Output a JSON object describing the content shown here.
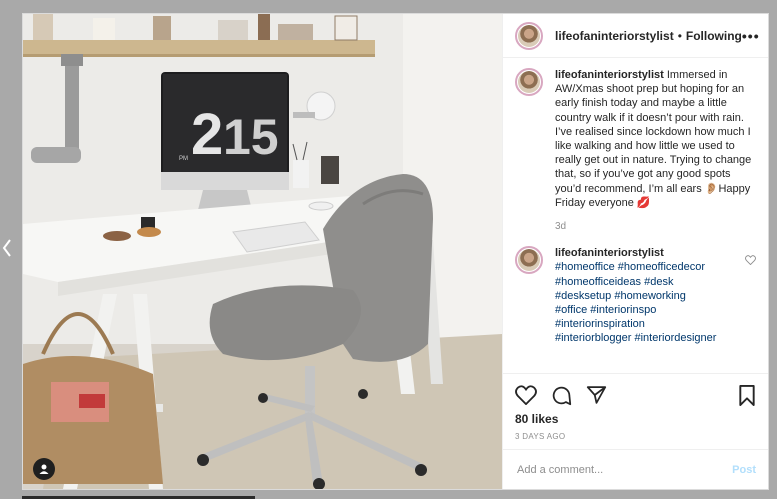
{
  "post": {
    "username": "lifeofaninteriorstylist",
    "separator": "•",
    "follow_status": "Following",
    "more_label": "•••",
    "caption": "Immersed in AW/Xmas shoot prep but hoping for an early finish today and maybe a little country walk if it doesn’t pour with rain. I’ve realised since lockdown how much I like walking and how little we used to really get out in nature. Trying to change that, so if you’ve got any good spots you’d recommend, I’m all ears 👂🏼Happy Friday everyone 💋",
    "caption_age": "3d",
    "hashtags_comment": {
      "username": "lifeofaninteriorstylist",
      "tags": [
        "#homeoffice",
        "#homeofficedecor",
        "#homeofficeideas",
        "#desk",
        "#desksetup",
        "#homeworking",
        "#office",
        "#interiorinspo",
        "#interiorinspiration",
        "#interiorblogger",
        "#interiordesigner"
      ]
    },
    "likes": "80 likes",
    "date": "3 DAYS AGO",
    "add_comment_placeholder": "Add a comment...",
    "post_button": "Post"
  },
  "photo": {
    "clock_hour": "2",
    "clock_minute": "15",
    "clock_period": "PM"
  },
  "icons": {
    "like": "heart-icon",
    "comment": "comment-icon",
    "share": "share-icon",
    "save": "bookmark-icon",
    "prev": "chevron-left-icon",
    "tag": "user-tag-icon",
    "comment_like": "heart-small-icon"
  },
  "colors": {
    "hashtag": "#00376b",
    "post_button": "#b2dffc",
    "avatar_ring": "#d8a7c0"
  }
}
